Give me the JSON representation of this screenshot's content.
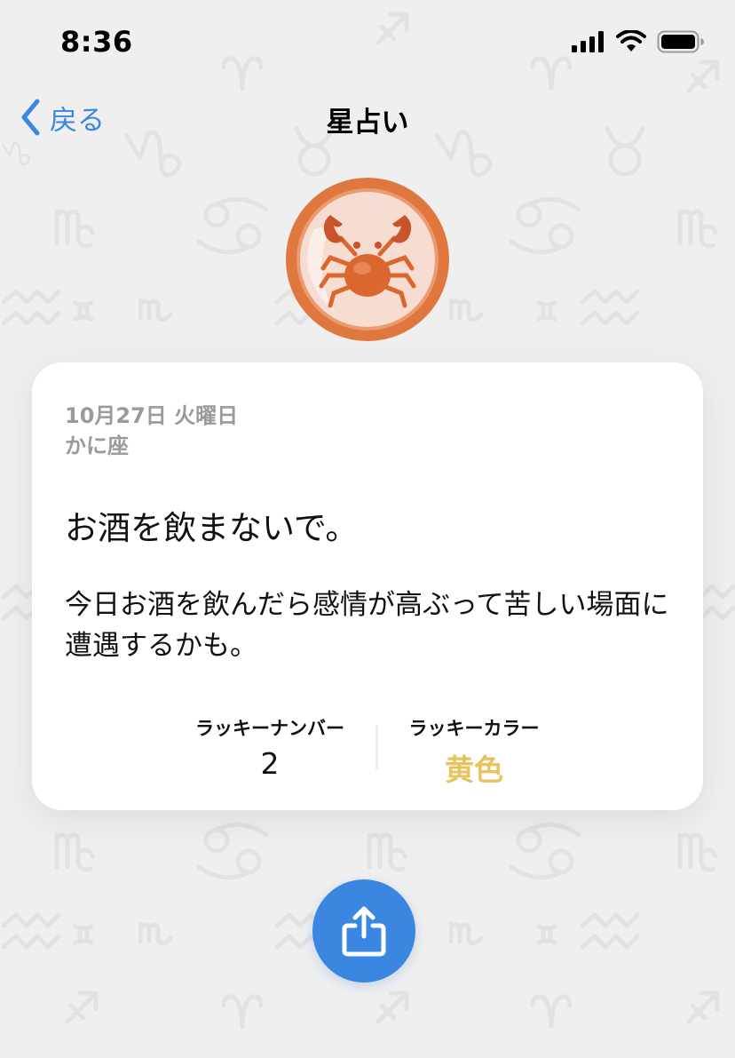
{
  "status_bar": {
    "time": "8:36",
    "icons": [
      "cellular-signal-icon",
      "wifi-icon",
      "battery-icon"
    ]
  },
  "nav": {
    "back_label": "戻る",
    "title": "星占い"
  },
  "emblem": {
    "icon": "crab-icon",
    "colors": {
      "ring": "#e0773f",
      "face": "#f7ddd1",
      "crab": "#db6630"
    }
  },
  "card": {
    "date": "10月27日 火曜日",
    "sign": "かに座",
    "headline": "お酒を飲まないで。",
    "body": "今日お酒を飲んだら感情が高ぶって苦しい場面に遭遇するかも。",
    "lucky_number_label": "ラッキーナンバー",
    "lucky_number_value": "2",
    "lucky_color_label": "ラッキーカラー",
    "lucky_color_value": "黄色"
  },
  "share": {
    "icon": "share-icon"
  },
  "colors": {
    "accent": "#3a86e0",
    "background": "#efefef",
    "lucky_color_text": "#e6c35d"
  }
}
